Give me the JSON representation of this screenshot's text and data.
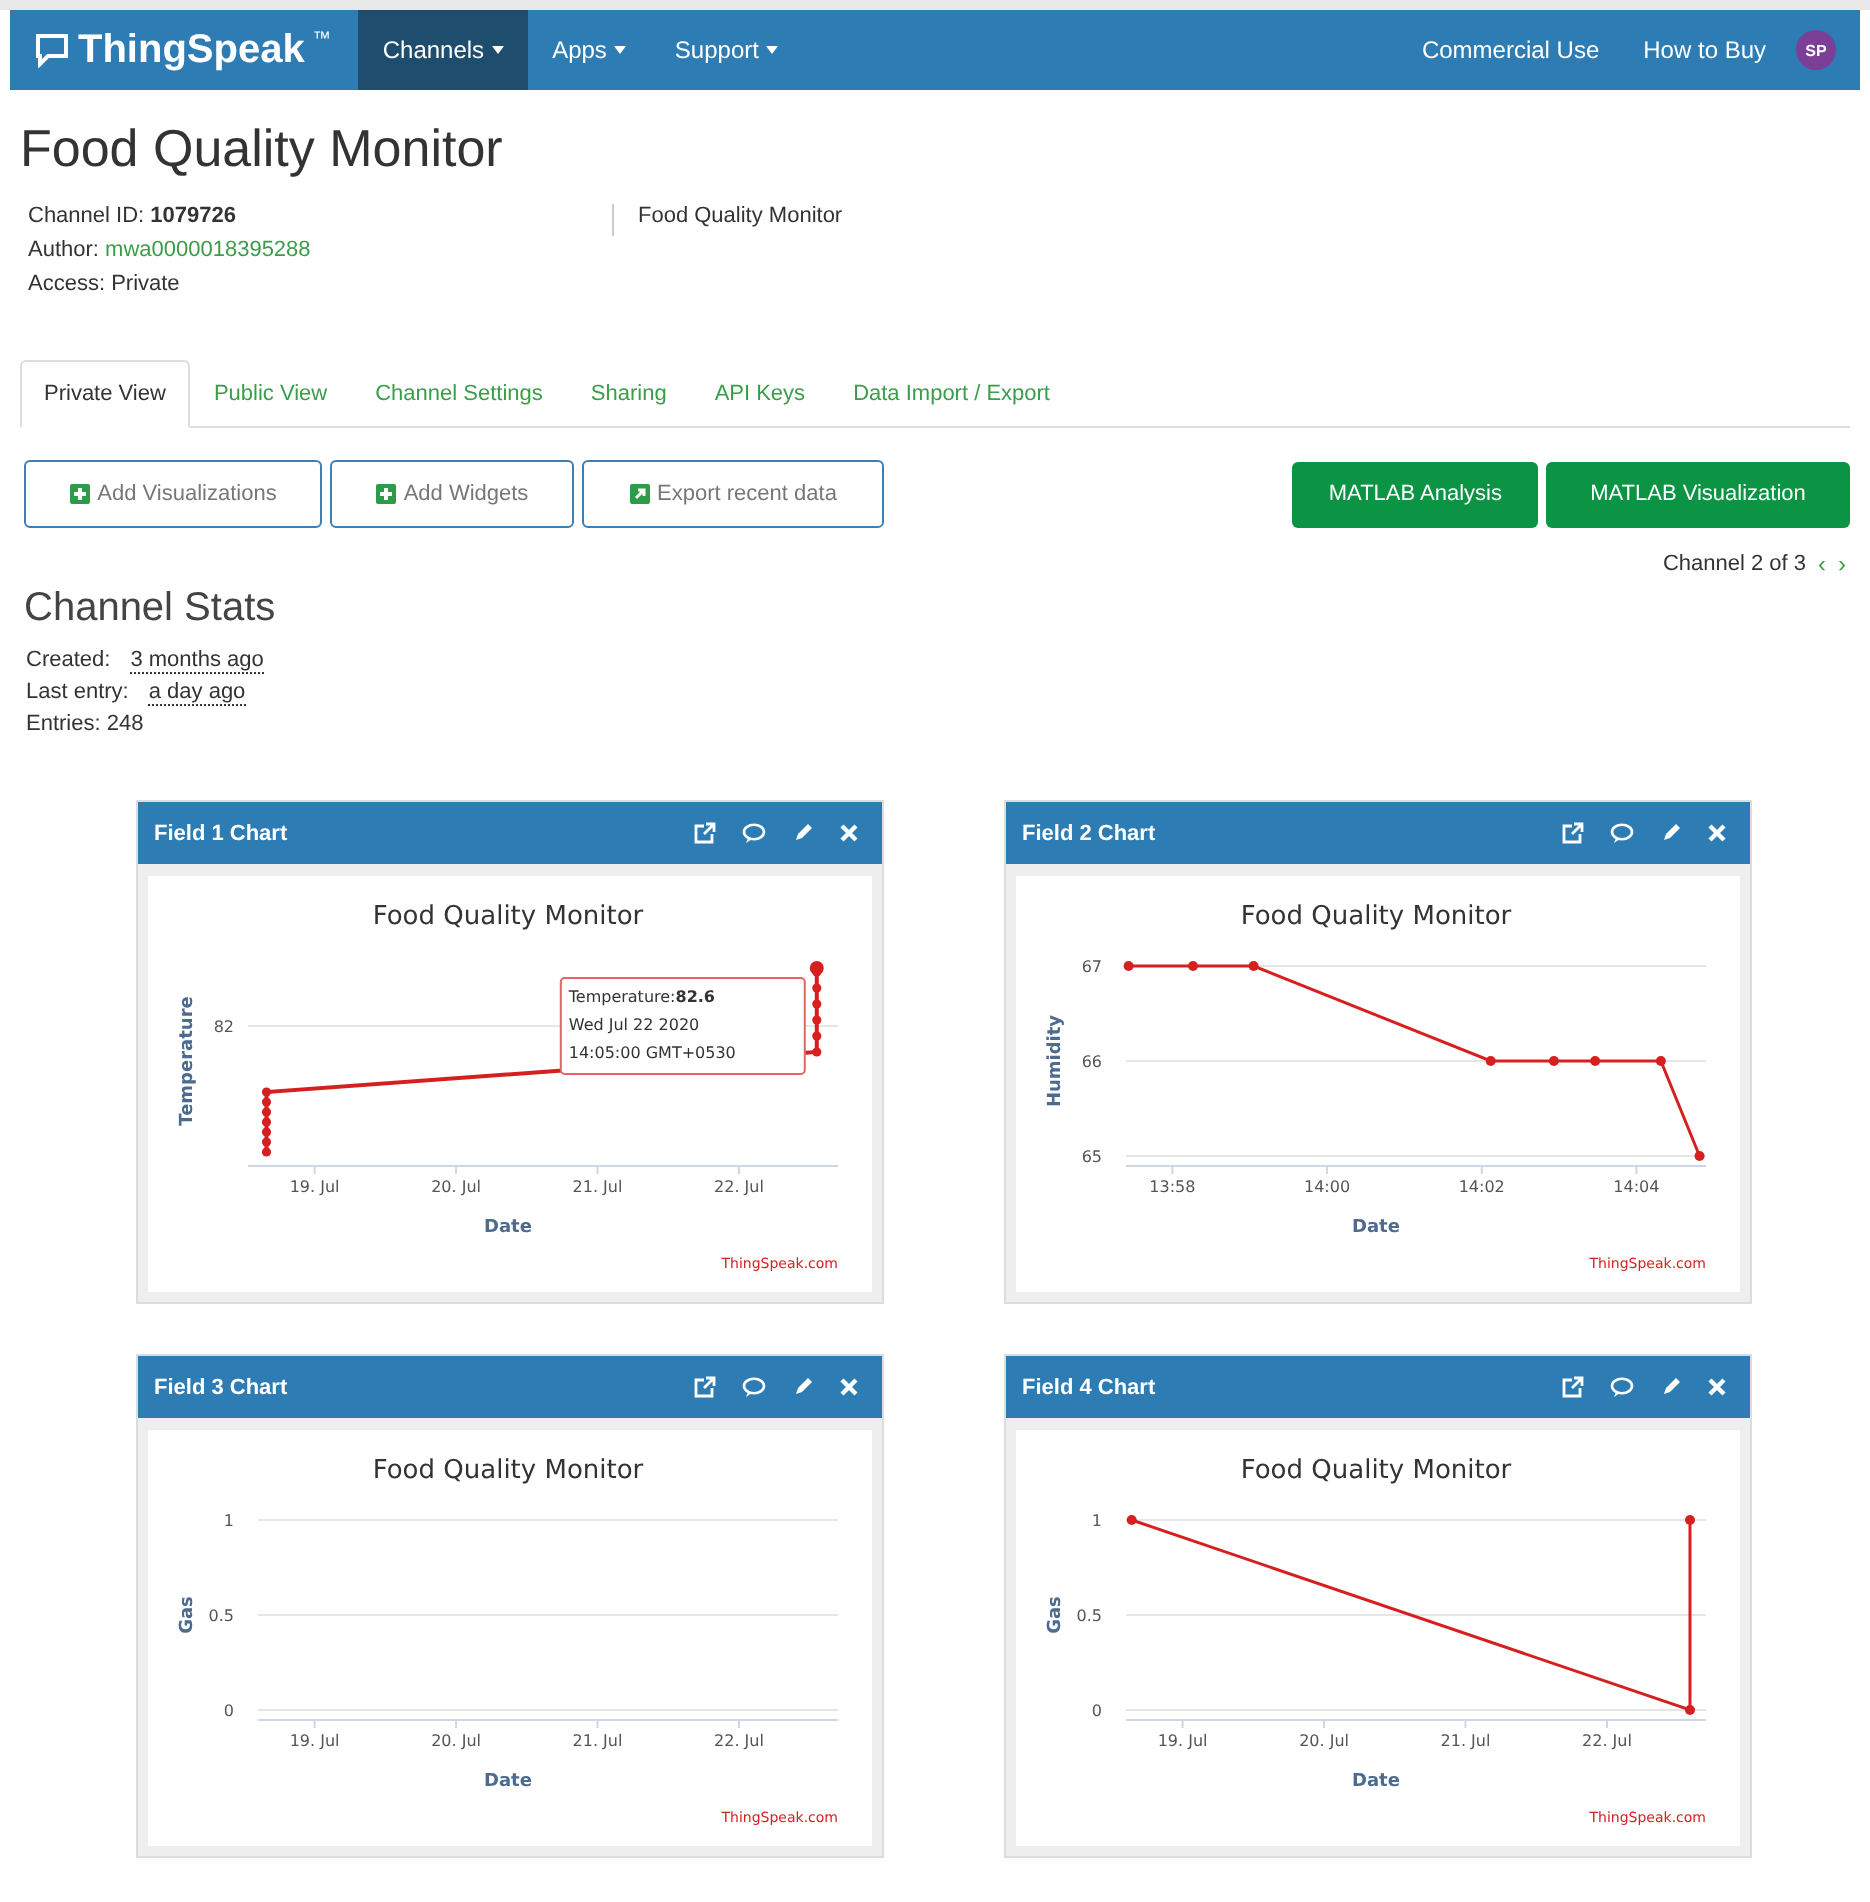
{
  "navbar": {
    "logo": "ThingSpeak",
    "logo_mark": "™",
    "menus": [
      {
        "label": "Channels",
        "selected": true
      },
      {
        "label": "Apps",
        "selected": false
      },
      {
        "label": "Support",
        "selected": false
      }
    ],
    "links": [
      "Commercial Use",
      "How to Buy"
    ],
    "avatar": "SP"
  },
  "title": "Food Quality Monitor",
  "info": {
    "channel_id_label": "Channel ID:",
    "channel_id": "1079726",
    "author_label": "Author:",
    "author": "mwa0000018395288",
    "access": "Access: Private",
    "description": "Food Quality Monitor"
  },
  "tabs": [
    {
      "label": "Private View",
      "selected": true
    },
    {
      "label": "Public View",
      "selected": false
    },
    {
      "label": "Channel Settings",
      "selected": false
    },
    {
      "label": "Sharing",
      "selected": false
    },
    {
      "label": "API Keys",
      "selected": false
    },
    {
      "label": "Data Import / Export",
      "selected": false
    }
  ],
  "actions": [
    {
      "label": "Add Visualizations",
      "kind": "add"
    },
    {
      "label": "Add Widgets",
      "kind": "add"
    },
    {
      "label": "Export recent data",
      "kind": "export"
    }
  ],
  "matlab_buttons": [
    "MATLAB Analysis",
    "MATLAB Visualization"
  ],
  "pager": "Channel 2 of 3",
  "pager_prev": "‹",
  "pager_next": "›",
  "stats": {
    "heading": "Channel Stats",
    "rows": [
      {
        "label": "Created:",
        "value": "3 months ago"
      },
      {
        "label": "Last entry:",
        "value": "a day ago"
      },
      {
        "label": "Entries: 248"
      }
    ]
  },
  "panels": [
    {
      "title": "Field 1 Chart",
      "credit": "ThingSpeak.com",
      "plot": {
        "title": "Food Quality Monitor",
        "xlabel": "Date",
        "ylabel": "Temperature",
        "yticks": [
          "82"
        ],
        "xticks": [
          "19. Jul",
          "20. Jul",
          "21. Jul",
          "22. Jul"
        ],
        "tooltip": [
          "Temperature:**82.6**",
          "Wed Jul 22 2020",
          "14:05:00 GMT+0530"
        ]
      }
    },
    {
      "title": "Field 2 Chart",
      "credit": "ThingSpeak.com",
      "chart_data": {
        "type": "line",
        "title": "Food Quality Monitor",
        "xlabel": "Date",
        "ylabel": "Humidity",
        "x": [
          "2020-07-22T13:57:26",
          "2020-07-22T13:58:16",
          "2020-07-22T13:59:03",
          "2020-07-22T14:02:07",
          "2020-07-22T14:02:56",
          "2020-07-22T14:03:28",
          "2020-07-22T14:04:19",
          "2020-07-22T14:04:49"
        ],
        "series": [
          {
            "color": "#d62020",
            "marker": true,
            "values": [
              67,
              67,
              67,
              66,
              66,
              66,
              66,
              65
            ]
          }
        ],
        "xlim": [
          "2020-07-22T13:57:24",
          "2020-07-22T14:04:54"
        ],
        "ylim": [
          65,
          67
        ],
        "xticks": [
          {
            "value": "2020-07-22T13:58",
            "label": "13:58"
          },
          {
            "value": "2020-07-22T14:00",
            "label": "14:00"
          },
          {
            "value": "2020-07-22T14:02",
            "label": "14:02"
          },
          {
            "value": "2020-07-22T14:04",
            "label": "14:04"
          }
        ],
        "yticks": [
          65,
          66,
          67
        ]
      }
    },
    {
      "title": "Field 3 Chart",
      "credit": "ThingSpeak.com",
      "chart_data": {
        "type": "line",
        "title": "Food Quality Monitor",
        "xlabel": "Date",
        "ylabel": "Gas",
        "xlim": [
          "2020-07-18T14:24",
          "2020-07-22T16:48"
        ],
        "ylim": [
          0,
          1
        ],
        "xticks": [
          {
            "value": "2020-07-19",
            "label": "19. Jul"
          },
          {
            "value": "2020-07-20",
            "label": "20. Jul"
          },
          {
            "value": "2020-07-21",
            "label": "21. Jul"
          },
          {
            "value": "2020-07-22",
            "label": "22. Jul"
          }
        ],
        "yticks": [
          0,
          0.5,
          1
        ]
      }
    },
    {
      "title": "Field 4 Chart",
      "credit": "ThingSpeak.com",
      "chart_data": {
        "type": "line",
        "title": "Food Quality Monitor",
        "xlabel": "Date",
        "ylabel": "Gas",
        "x": [
          "2020-07-18T15:22",
          "2020-07-22T14:05",
          "2020-07-22T14:05"
        ],
        "series": [
          {
            "color": "#d62020",
            "marker": true,
            "values": [
              1,
              0,
              1
            ]
          }
        ],
        "xlim": [
          "2020-07-18T14:24",
          "2020-07-22T16:48"
        ],
        "ylim": [
          0,
          1
        ],
        "xticks": [
          {
            "value": "2020-07-19",
            "label": "19. Jul"
          },
          {
            "value": "2020-07-20",
            "label": "20. Jul"
          },
          {
            "value": "2020-07-21",
            "label": "21. Jul"
          },
          {
            "value": "2020-07-22",
            "label": "22. Jul"
          }
        ],
        "yticks": [
          0,
          0.5,
          1
        ]
      }
    }
  ]
}
